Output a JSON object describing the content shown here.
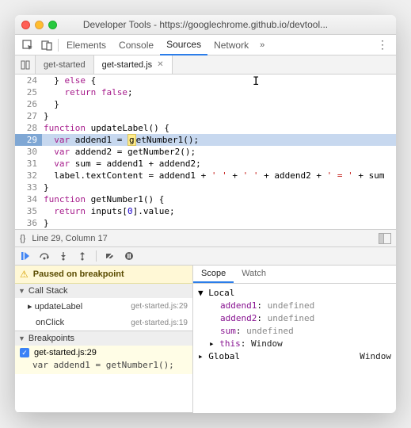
{
  "window": {
    "title": "Developer Tools - https://googlechrome.github.io/devtool..."
  },
  "toolbar": {
    "tabs": [
      "Elements",
      "Console",
      "Sources",
      "Network"
    ],
    "active_index": 2,
    "more_glyph": "»",
    "kebab_glyph": "⋮"
  },
  "file_tabs": {
    "items": [
      {
        "label": "get-started",
        "closable": false
      },
      {
        "label": "get-started.js",
        "closable": true
      }
    ],
    "active_index": 1
  },
  "code": {
    "lines": [
      {
        "n": 24,
        "html": "  } <span class='kw'>else</span> {"
      },
      {
        "n": 25,
        "html": "    <span class='kw'>return</span> <span class='kw'>false</span>;"
      },
      {
        "n": 26,
        "html": "  }"
      },
      {
        "n": 27,
        "html": "}"
      },
      {
        "n": 28,
        "html": "<span class='kw'>function</span> updateLabel() {"
      },
      {
        "n": 29,
        "html": "  <span class='kw'>var</span> addend1 = <span class='hlspan'>g</span>etNumber1();",
        "highlight": true
      },
      {
        "n": 30,
        "html": "  <span class='kw'>var</span> addend2 = getNumber2();"
      },
      {
        "n": 31,
        "html": "  <span class='kw'>var</span> sum = addend1 + addend2;"
      },
      {
        "n": 32,
        "html": "  label.textContent = addend1 + <span class='str'>' '</span> + <span class='str'>' '</span> + addend2 + <span class='str'>' = '</span> + sum"
      },
      {
        "n": 33,
        "html": "}"
      },
      {
        "n": 34,
        "html": "<span class='kw'>function</span> getNumber1() {"
      },
      {
        "n": 35,
        "html": "  <span class='kw'>return</span> inputs[<span class='num'>0</span>].value;"
      },
      {
        "n": 36,
        "html": "}"
      }
    ]
  },
  "status": {
    "braces": "{}",
    "position": "Line 29, Column 17"
  },
  "paused": {
    "text": "Paused on breakpoint"
  },
  "callstack": {
    "title": "Call Stack",
    "frames": [
      {
        "fn": "updateLabel",
        "loc": "get-started.js:29"
      },
      {
        "fn": "onClick",
        "loc": "get-started.js:19"
      }
    ]
  },
  "breakpoints": {
    "title": "Breakpoints",
    "items": [
      {
        "label": "get-started.js:29",
        "code": "var addend1 = getNumber1();",
        "checked": true
      }
    ]
  },
  "scope_watch": {
    "tabs": [
      "Scope",
      "Watch"
    ],
    "active_index": 0
  },
  "scope": {
    "local": {
      "label": "Local",
      "vars": [
        {
          "name": "addend1",
          "value": "undefined"
        },
        {
          "name": "addend2",
          "value": "undefined"
        },
        {
          "name": "sum",
          "value": "undefined"
        }
      ],
      "this": {
        "name": "this",
        "value": "Window"
      }
    },
    "global": {
      "label": "Global",
      "value": "Window"
    }
  }
}
